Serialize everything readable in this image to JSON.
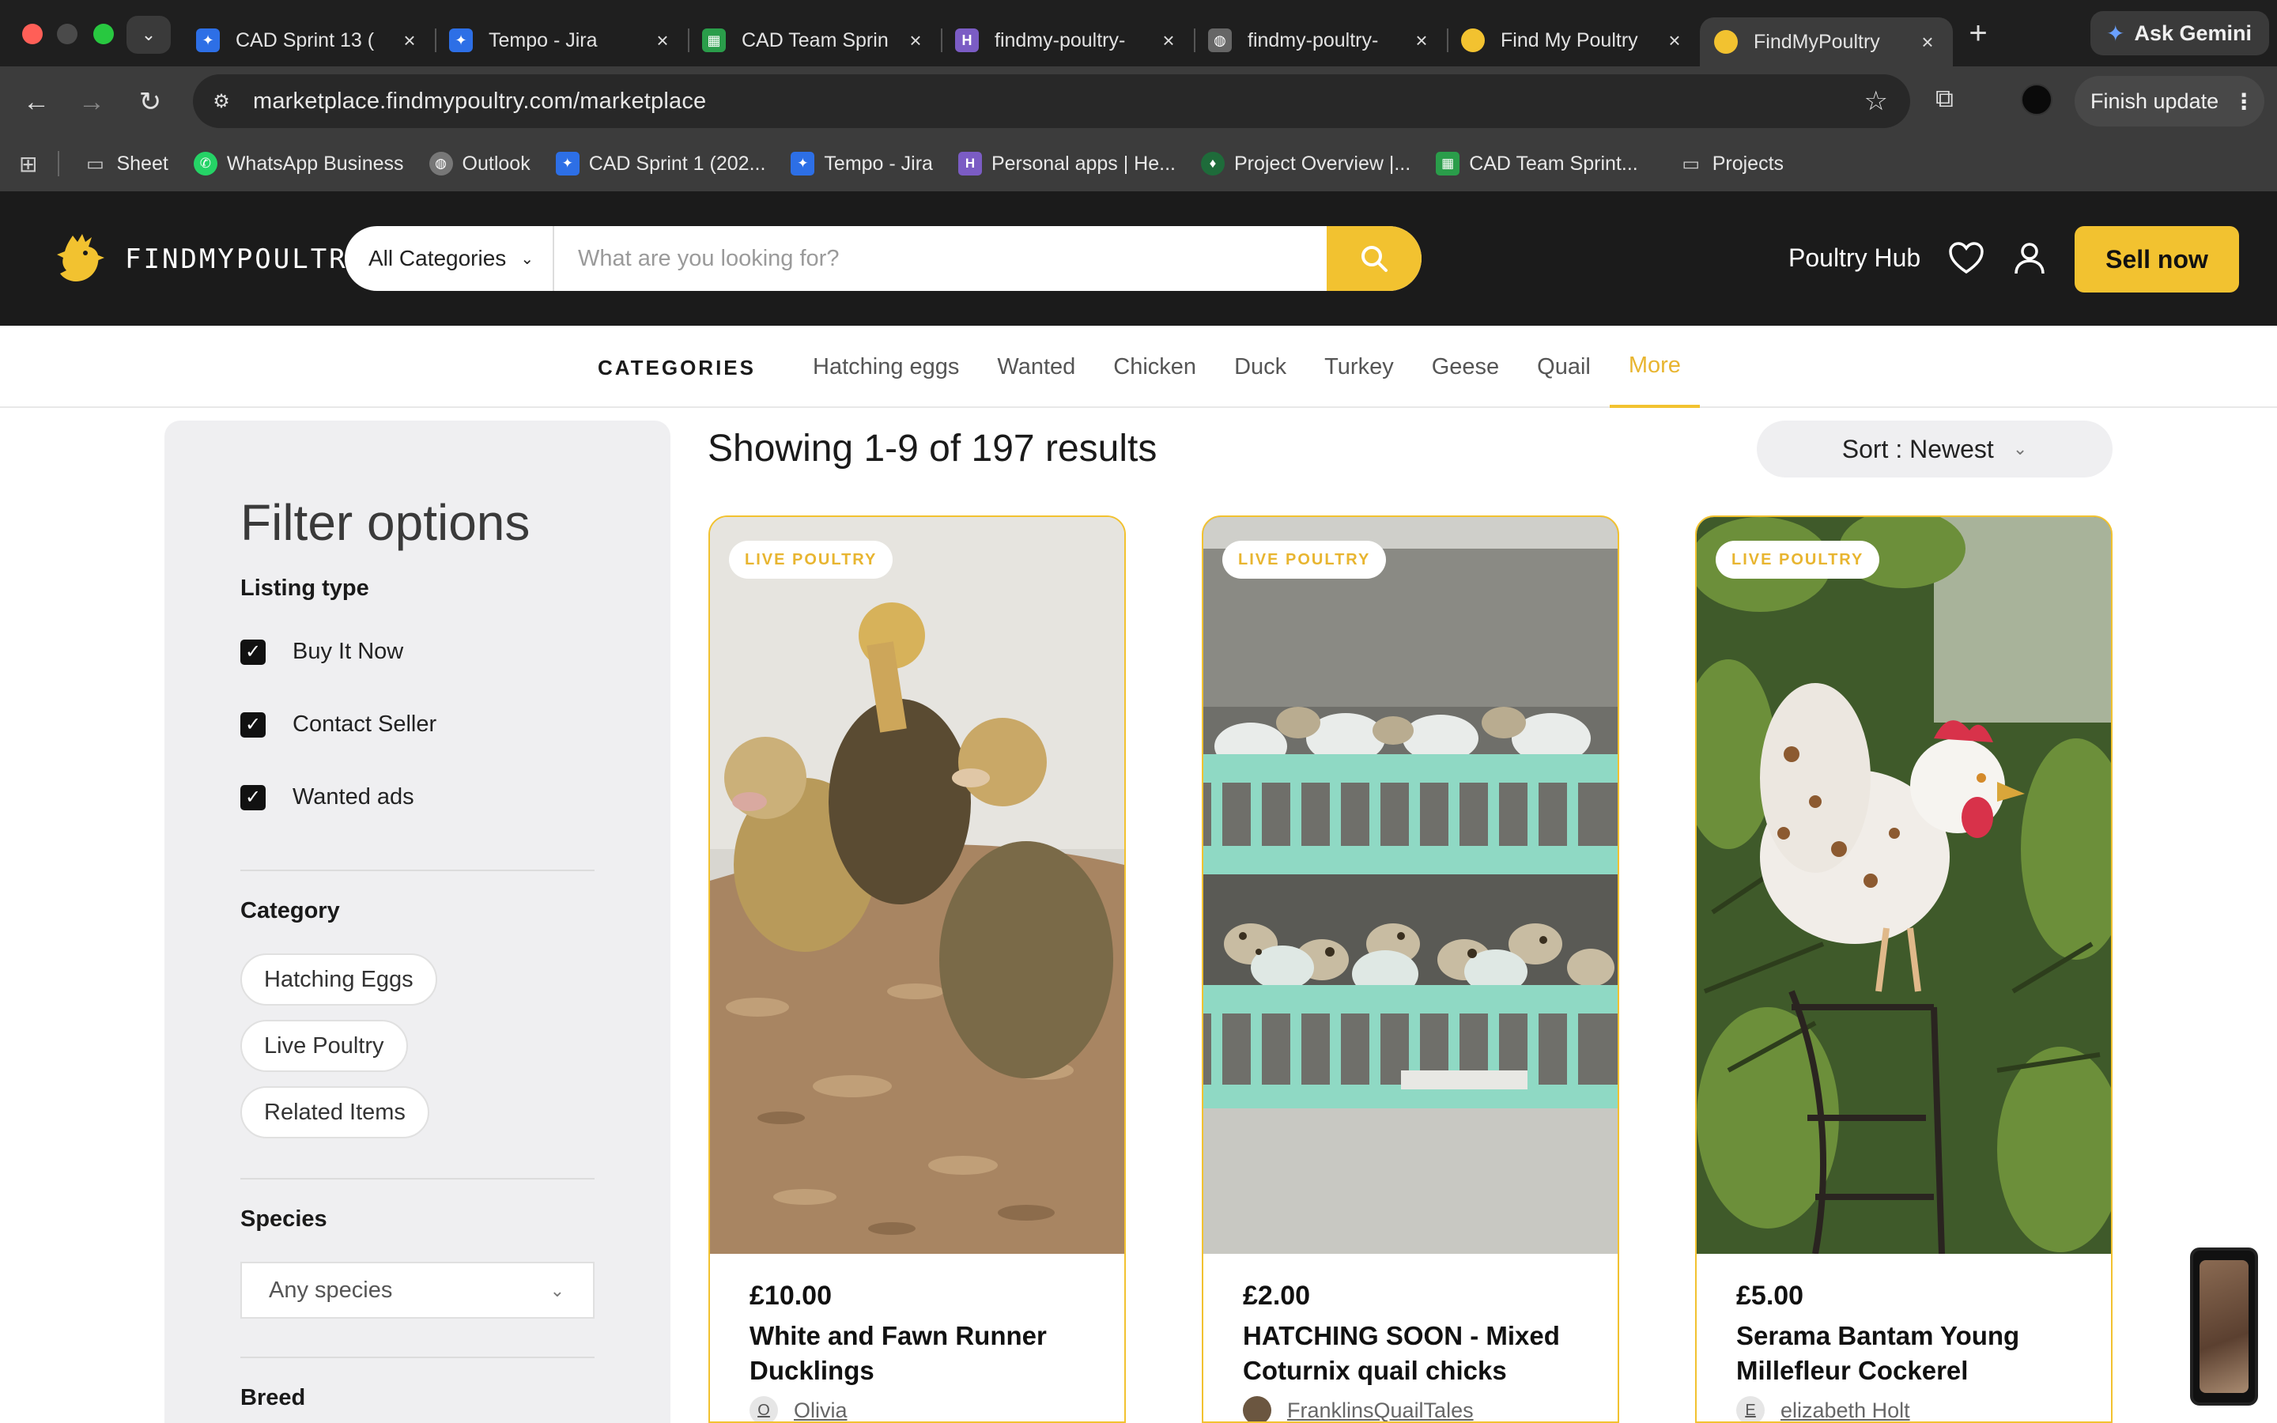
{
  "browser": {
    "tabs": [
      {
        "title": "CAD Sprint 13 (",
        "icon": "jira-icon",
        "color": "#2d6fe6"
      },
      {
        "title": "Tempo - Jira",
        "icon": "jira-icon",
        "color": "#2d6fe6"
      },
      {
        "title": "CAD Team Sprin",
        "icon": "sheets-icon",
        "color": "#2a9d4a"
      },
      {
        "title": "findmy-poultry-",
        "icon": "heroku-icon",
        "color": "#7b5cc4"
      },
      {
        "title": "findmy-poultry-",
        "icon": "globe-icon",
        "color": "#666666"
      },
      {
        "title": "Find My Poultry",
        "icon": "fmp-icon",
        "color": "#f2c230"
      },
      {
        "title": "FindMyPoultry",
        "icon": "fmp-icon",
        "color": "#f2c230"
      }
    ],
    "ask_gemini": "Ask Gemini",
    "url": "marketplace.findmypoultry.com/marketplace",
    "finish_update": "Finish update",
    "bookmarks": [
      {
        "label": "Sheet",
        "icon": "folder-icon"
      },
      {
        "label": "WhatsApp Business",
        "icon": "whatsapp-icon"
      },
      {
        "label": "Outlook",
        "icon": "globe-icon"
      },
      {
        "label": "CAD Sprint 1 (202...",
        "icon": "jira-icon"
      },
      {
        "label": "Tempo - Jira",
        "icon": "jira-icon"
      },
      {
        "label": "Personal apps | He...",
        "icon": "heroku-icon"
      },
      {
        "label": "Project Overview |...",
        "icon": "leaf-icon"
      },
      {
        "label": "CAD Team Sprint...",
        "icon": "sheets-icon"
      },
      {
        "label": "Projects",
        "icon": "folder-icon"
      }
    ]
  },
  "header": {
    "logo_text": "FINDMYPOULTRY",
    "category_select": "All Categories",
    "search_placeholder": "What are you looking for?",
    "poultry_hub": "Poultry Hub",
    "sell_now": "Sell now",
    "accent": "#f2c230"
  },
  "catnav": {
    "label": "CATEGORIES",
    "links": [
      "Hatching eggs",
      "Wanted",
      "Chicken",
      "Duck",
      "Turkey",
      "Geese",
      "Quail",
      "More"
    ]
  },
  "filters": {
    "title": "Filter options",
    "listing_type": {
      "heading": "Listing type",
      "options": [
        {
          "label": "Buy It Now",
          "checked": true
        },
        {
          "label": "Contact Seller",
          "checked": true
        },
        {
          "label": "Wanted ads",
          "checked": true
        }
      ]
    },
    "category": {
      "heading": "Category",
      "chips": [
        "Hatching Eggs",
        "Live Poultry",
        "Related Items"
      ]
    },
    "species": {
      "heading": "Species",
      "selected": "Any species"
    },
    "breed": {
      "heading": "Breed"
    }
  },
  "results": {
    "count_text": "Showing 1-9 of 197 results",
    "sort": "Sort : Newest",
    "cards": [
      {
        "badge": "LIVE POULTRY",
        "price": "£10.00",
        "title": "White and Fawn Runner Ducklings",
        "seller": "Olivia",
        "avatar": "O"
      },
      {
        "badge": "LIVE POULTRY",
        "price": "£2.00",
        "title": "HATCHING SOON - Mixed Coturnix quail chicks",
        "seller": "FranklinsQuailTales",
        "avatar": ""
      },
      {
        "badge": "LIVE POULTRY",
        "price": "£5.00",
        "title": "Serama Bantam Young Millefleur Cockerel",
        "seller": "elizabeth Holt",
        "avatar": "E"
      }
    ]
  }
}
